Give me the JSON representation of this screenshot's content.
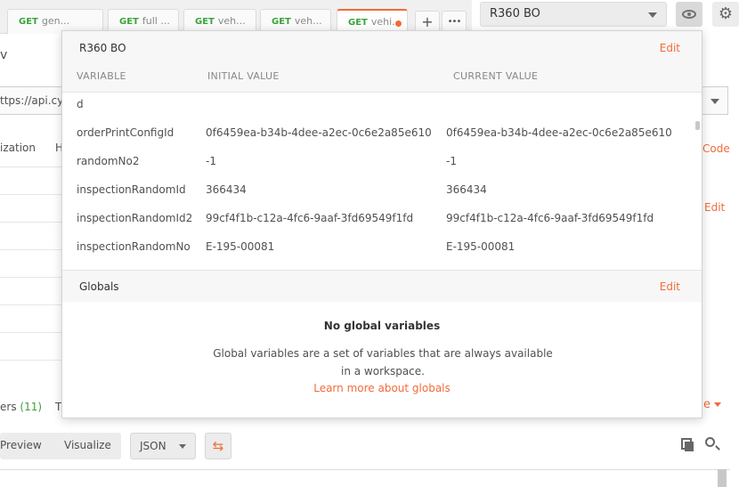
{
  "tabs": [
    {
      "method": "GET",
      "label": "gen..."
    },
    {
      "method": "GET",
      "label": "full ..."
    },
    {
      "method": "GET",
      "label": "veh..."
    },
    {
      "method": "GET",
      "label": "veh..."
    },
    {
      "method": "GET",
      "label": "vehi..."
    }
  ],
  "tab_actions": {
    "add": "+",
    "more": "•••"
  },
  "environment": {
    "selected": "R360 BO"
  },
  "request": {
    "url_fragment": "ttps://api.cyb",
    "tab_auth_fragment": "ization",
    "tab_h_fragment": "H",
    "code_link": "Code",
    "edit_link": "Edit",
    "method_fragment": "v"
  },
  "response": {
    "headers_fragment": "ers",
    "headers_count": "(11)",
    "t_fragment": "T",
    "e_fragment": "e",
    "preview": "Preview",
    "visualize": "Visualize",
    "format": "JSON"
  },
  "quicklook": {
    "env_title": "R360 BO",
    "edit": "Edit",
    "columns": {
      "variable": "VARIABLE",
      "initial": "INITIAL VALUE",
      "current": "CURRENT VALUE"
    },
    "variables": [
      {
        "name": "d",
        "initial": "",
        "current": ""
      },
      {
        "name": "orderPrintConfigId",
        "initial": "0f6459ea-b34b-4dee-a2ec-0c6e2a85e610",
        "current": "0f6459ea-b34b-4dee-a2ec-0c6e2a85e610"
      },
      {
        "name": "randomNo2",
        "initial": "-1",
        "current": "-1"
      },
      {
        "name": "inspectionRandomId",
        "initial": "366434",
        "current": "366434"
      },
      {
        "name": "inspectionRandomId2",
        "initial": "99cf4f1b-c12a-4fc6-9aaf-3fd69549f1fd",
        "current": "99cf4f1b-c12a-4fc6-9aaf-3fd69549f1fd"
      },
      {
        "name": "inspectionRandomNo",
        "initial": "E-195-00081",
        "current": "E-195-00081"
      }
    ],
    "globals": {
      "title": "Globals",
      "edit": "Edit",
      "empty_title": "No global variables",
      "empty_desc": "Global variables are a set of variables that are always available in a workspace.",
      "learn_more": "Learn more about globals"
    }
  },
  "icons": {
    "eye": "eye-icon",
    "gear": "gear-icon",
    "copy": "copy-icon",
    "search": "search-icon",
    "wrap": "wrap-lines-icon"
  },
  "colors": {
    "accent": "#f26b3a",
    "get_method": "#3aa33a"
  }
}
